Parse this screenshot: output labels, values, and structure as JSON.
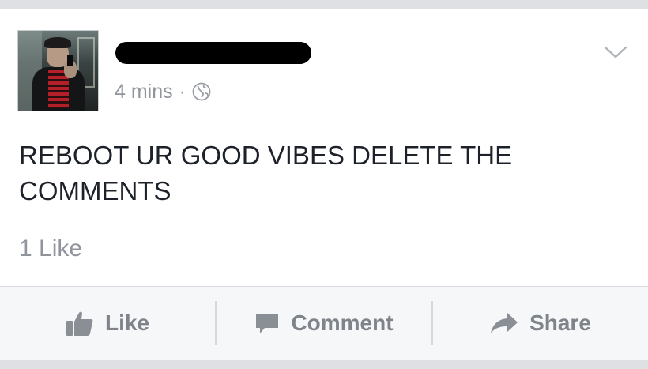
{
  "post": {
    "timestamp": "4 mins",
    "separator": "·",
    "privacy_icon": "globe-icon",
    "text": "REBOOT UR GOOD VIBES DELETE THE COMMENTS",
    "likes_count": "1 Like"
  },
  "actions": {
    "like_label": "Like",
    "comment_label": "Comment",
    "share_label": "Share"
  },
  "colors": {
    "text_primary": "#1d2129",
    "text_secondary": "#90949c",
    "action_text": "#7f848b",
    "background": "#dfe0e4"
  }
}
